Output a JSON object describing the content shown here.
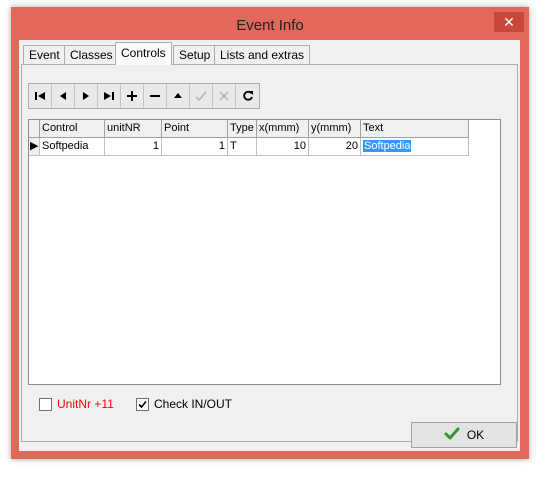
{
  "window": {
    "title": "Event Info",
    "close_glyph": "✕"
  },
  "tabs": [
    {
      "label": "Event"
    },
    {
      "label": "Classes"
    },
    {
      "label": "Controls"
    },
    {
      "label": "Setup"
    },
    {
      "label": "Lists and extras"
    }
  ],
  "active_tab": "Controls",
  "navigator": {
    "buttons": [
      "first-icon",
      "prior-icon",
      "next-icon",
      "last-icon",
      "insert-icon",
      "delete-icon",
      "edit-icon",
      "post-icon",
      "cancel-icon",
      "refresh-icon"
    ]
  },
  "grid": {
    "columns": [
      "Control",
      "unitNR",
      "Point",
      "Type",
      "x(mmm)",
      "y(mmm)",
      "Text"
    ],
    "rows": [
      {
        "indicator": "▶",
        "Control": "Softpedia",
        "unitNR": "1",
        "Point": "1",
        "Type": "T",
        "x": "10",
        "y": "20",
        "Text": "Softpedia"
      }
    ]
  },
  "options": {
    "unitnr_label": "UnitNr +11",
    "unitnr_color": "#ff0000",
    "unitnr_checked": false,
    "checkinout_label": "Check IN/OUT",
    "checkinout_checked": true
  },
  "ok_button": {
    "label": "OK",
    "icon": "checkmark-icon",
    "icon_color": "#2e9a2e"
  },
  "colors": {
    "titlebar": "#e1685a",
    "close": "#c7493c",
    "selection": "#3399ff"
  }
}
